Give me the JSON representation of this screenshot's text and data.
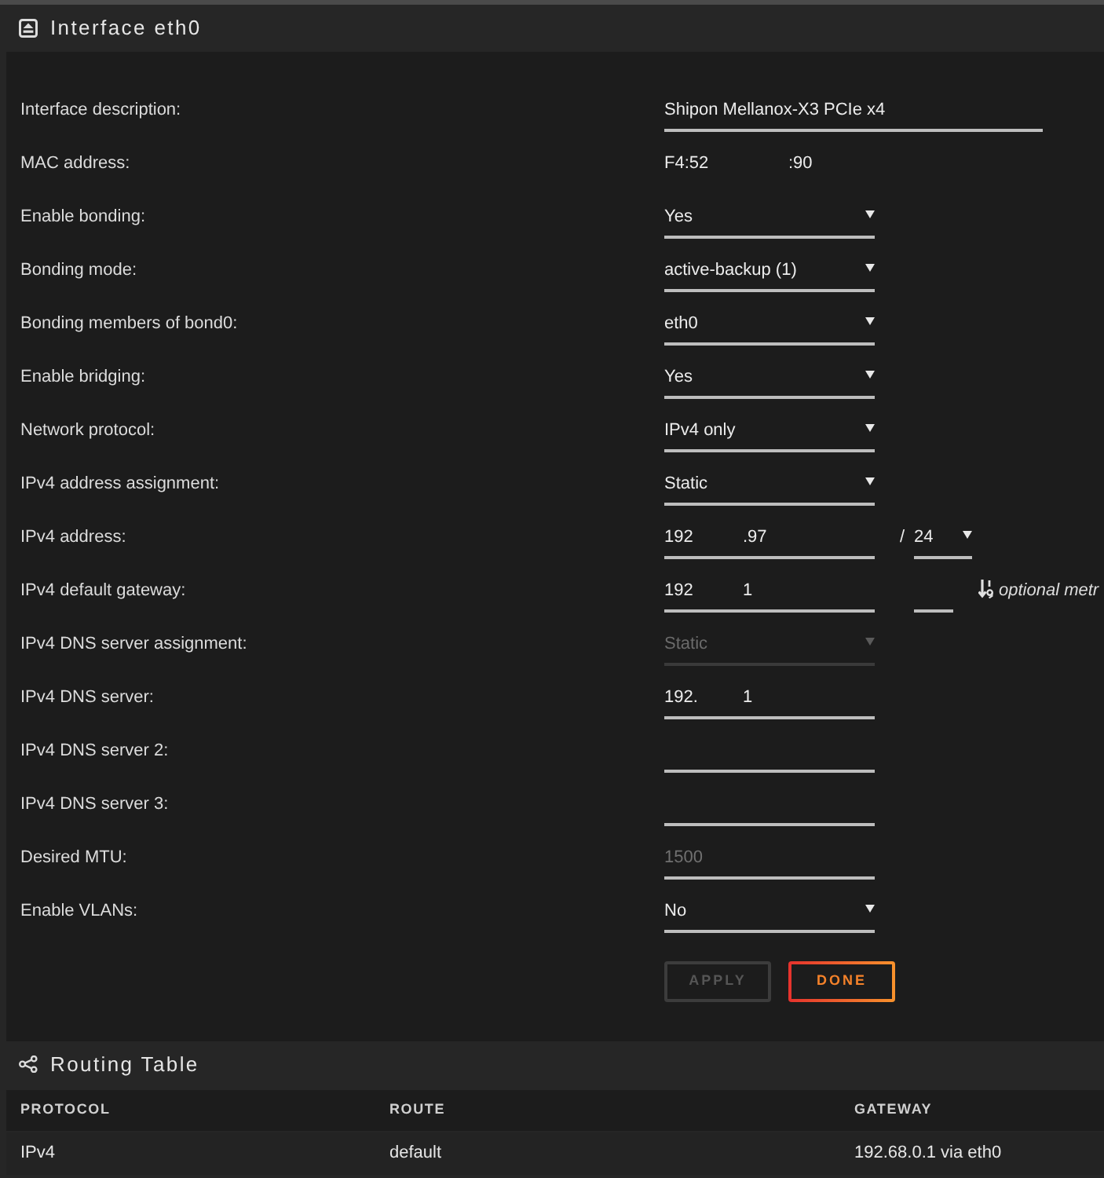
{
  "panel": {
    "title": "Interface eth0"
  },
  "fields": [
    {
      "label": "Interface description:",
      "kind": "wide_input",
      "value": "Shipon Mellanox-X3 PCIe x4",
      "disabled": false
    },
    {
      "label": "MAC address:",
      "kind": "static",
      "value_parts": [
        "F4:52",
        ":90"
      ],
      "disabled": false
    },
    {
      "label": "Enable bonding:",
      "kind": "select",
      "value": "Yes",
      "disabled": false
    },
    {
      "label": "Bonding mode:",
      "kind": "select",
      "value": "active-backup (1)",
      "disabled": false
    },
    {
      "label": "Bonding members of bond0:",
      "kind": "select",
      "value": "eth0",
      "disabled": false
    },
    {
      "label": "Enable bridging:",
      "kind": "select",
      "value": "Yes",
      "disabled": false
    },
    {
      "label": "Network protocol:",
      "kind": "select",
      "value": "IPv4 only",
      "disabled": false
    },
    {
      "label": "IPv4 address assignment:",
      "kind": "select",
      "value": "Static",
      "disabled": false
    },
    {
      "label": "IPv4 address:",
      "kind": "address",
      "value_parts": [
        "192",
        ".97"
      ],
      "prefix": {
        "separator": "/",
        "value": "24"
      },
      "disabled": false
    },
    {
      "label": "IPv4 default gateway:",
      "kind": "address",
      "value_parts": [
        "192",
        "1"
      ],
      "metric_note": "optional metr",
      "disabled": false
    },
    {
      "label": "IPv4 DNS server assignment:",
      "kind": "select",
      "value": "Static",
      "disabled": true
    },
    {
      "label": "IPv4 DNS server:",
      "kind": "address",
      "value_parts": [
        "192.",
        "1"
      ],
      "disabled": false
    },
    {
      "label": "IPv4 DNS server 2:",
      "kind": "input",
      "disabled": false
    },
    {
      "label": "IPv4 DNS server 3:",
      "kind": "input",
      "disabled": false
    },
    {
      "label": "Desired MTU:",
      "kind": "input",
      "placeholder": "1500",
      "disabled": false
    },
    {
      "label": "Enable VLANs:",
      "kind": "select",
      "value": "No",
      "disabled": false
    }
  ],
  "buttons": [
    {
      "label": "APPLY",
      "disabled": true
    },
    {
      "label": "DONE",
      "disabled": false
    }
  ],
  "routing_table": {
    "title": "Routing Table",
    "columns": [
      "PROTOCOL",
      "ROUTE",
      "GATEWAY"
    ],
    "rows": [
      [
        "IPv4",
        "default",
        "192.68.0.1 via eth0"
      ]
    ]
  }
}
